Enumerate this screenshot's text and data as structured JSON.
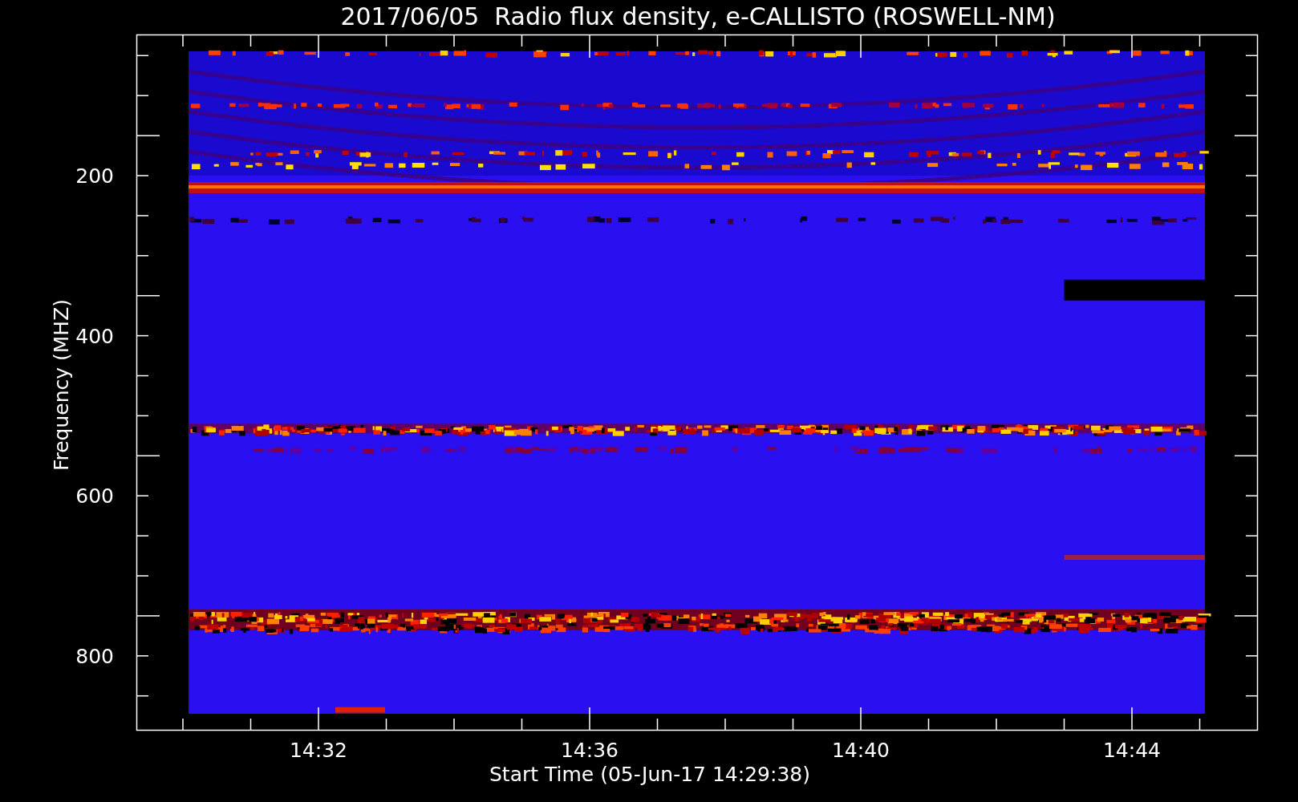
{
  "plot": {
    "title": "2017/06/05  Radio flux density, e-CALLISTO (ROSWELL-NM)",
    "xlabel": "Start Time (05-Jun-17 14:29:38)",
    "ylabel": "Frequency (MHZ)",
    "yticks": [
      {
        "label": "200"
      },
      {
        "label": "400"
      },
      {
        "label": "600"
      },
      {
        "label": "800"
      }
    ],
    "xticks": [
      {
        "label": "14:32"
      },
      {
        "label": "14:36"
      },
      {
        "label": "14:40"
      },
      {
        "label": "14:44"
      }
    ]
  }
}
